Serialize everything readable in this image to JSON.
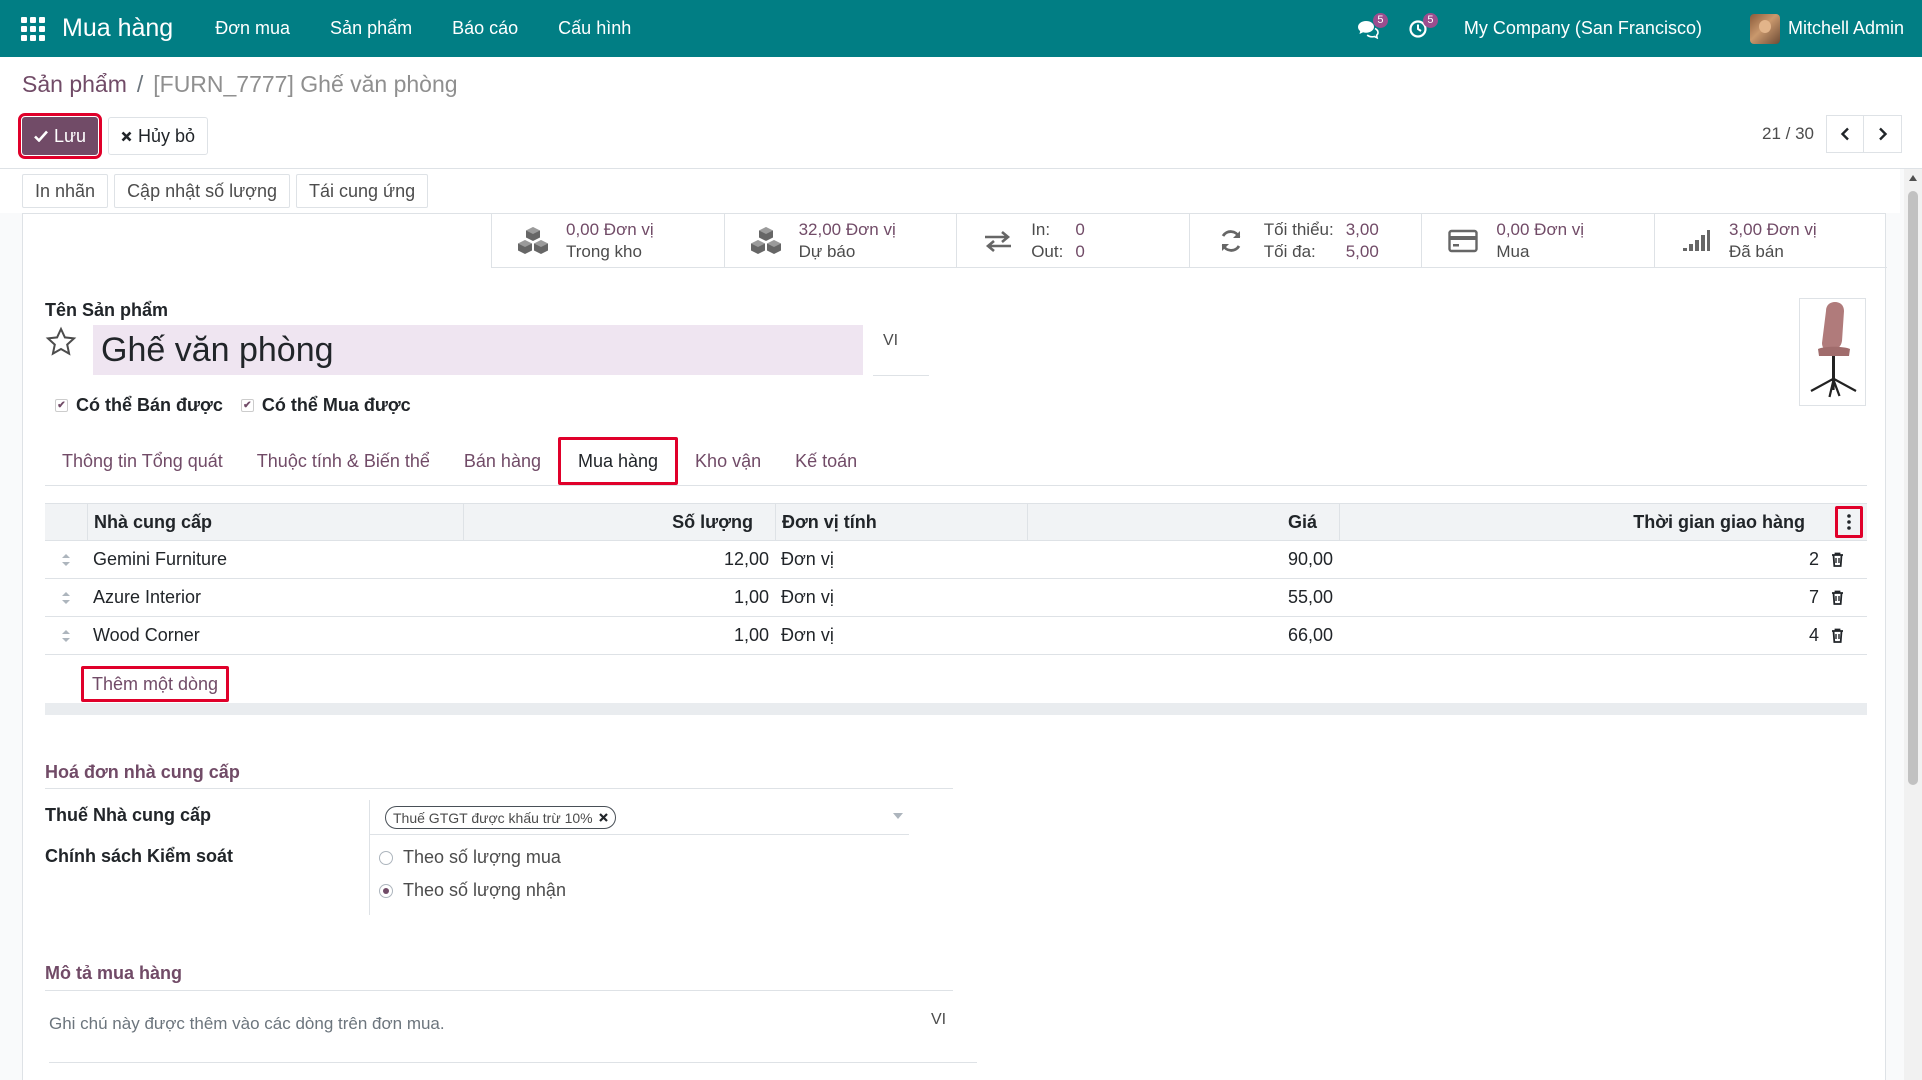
{
  "navbar": {
    "app_name": "Mua hàng",
    "menu": [
      "Đơn mua",
      "Sản phẩm",
      "Báo cáo",
      "Cấu hình"
    ],
    "messages_badge": "5",
    "activities_badge": "5",
    "company": "My Company (San Francisco)",
    "user": "Mitchell Admin"
  },
  "breadcrumb": {
    "parent": "Sản phẩm",
    "separator": "/",
    "current": "[FURN_7777] Ghế văn phòng"
  },
  "buttons": {
    "save": "Lưu",
    "discard": "Hủy bỏ"
  },
  "pager": {
    "text": "21 / 30"
  },
  "actions": [
    "In nhãn",
    "Cập nhật số lượng",
    "Tái cung ứng"
  ],
  "stats": {
    "on_hand_value": "0,00 Đơn vị",
    "on_hand_label": "Trong kho",
    "forecast_value": "32,00 Đơn vị",
    "forecast_label": "Dự báo",
    "in_label": "In:",
    "in_value": "0",
    "out_label": "Out:",
    "out_value": "0",
    "min_label": "Tối thiểu:",
    "min_value": "3,00",
    "max_label": "Tối đa:",
    "max_value": "5,00",
    "purchased_value": "0,00 Đơn vị",
    "purchased_label": "Mua",
    "sold_value": "3,00 Đơn vị",
    "sold_label": "Đã bán"
  },
  "product": {
    "name_label": "Tên Sản phẩm",
    "name": "Ghế văn phòng",
    "lang": "VI",
    "can_sell": "Có thể Bán được",
    "can_purchase": "Có thể Mua được"
  },
  "tabs": [
    "Thông tin Tổng quát",
    "Thuộc tính & Biến thể",
    "Bán hàng",
    "Mua hàng",
    "Kho vận",
    "Kế toán"
  ],
  "vendors_table": {
    "headers": [
      "Nhà cung cấp",
      "Số lượng",
      "Đơn vị tính",
      "Giá",
      "Thời gian giao hàng"
    ],
    "rows": [
      {
        "vendor": "Gemini Furniture",
        "qty": "12,00",
        "uom": "Đơn vị",
        "price": "90,00",
        "delay": "2"
      },
      {
        "vendor": "Azure Interior",
        "qty": "1,00",
        "uom": "Đơn vị",
        "price": "55,00",
        "delay": "7"
      },
      {
        "vendor": "Wood Corner",
        "qty": "1,00",
        "uom": "Đơn vị",
        "price": "66,00",
        "delay": "4"
      }
    ],
    "add_line": "Thêm một dòng"
  },
  "vendor_bills": {
    "section_title": "Hoá đơn nhà cung cấp",
    "tax_label": "Thuế Nhà cung cấp",
    "tax_tag": "Thuế GTGT được khấu trừ 10%",
    "policy_label": "Chính sách Kiểm soát",
    "policy_options": [
      "Theo số lượng mua",
      "Theo số lượng nhận"
    ],
    "policy_selected": 1
  },
  "purchase_description": {
    "section_title": "Mô tả mua hàng",
    "placeholder": "Ghi chú này được thêm vào các dòng trên đơn mua.",
    "lang": "VI"
  },
  "colors": {
    "navbar": "#017e84",
    "brand": "#714b67",
    "highlight": "#e0002a"
  }
}
